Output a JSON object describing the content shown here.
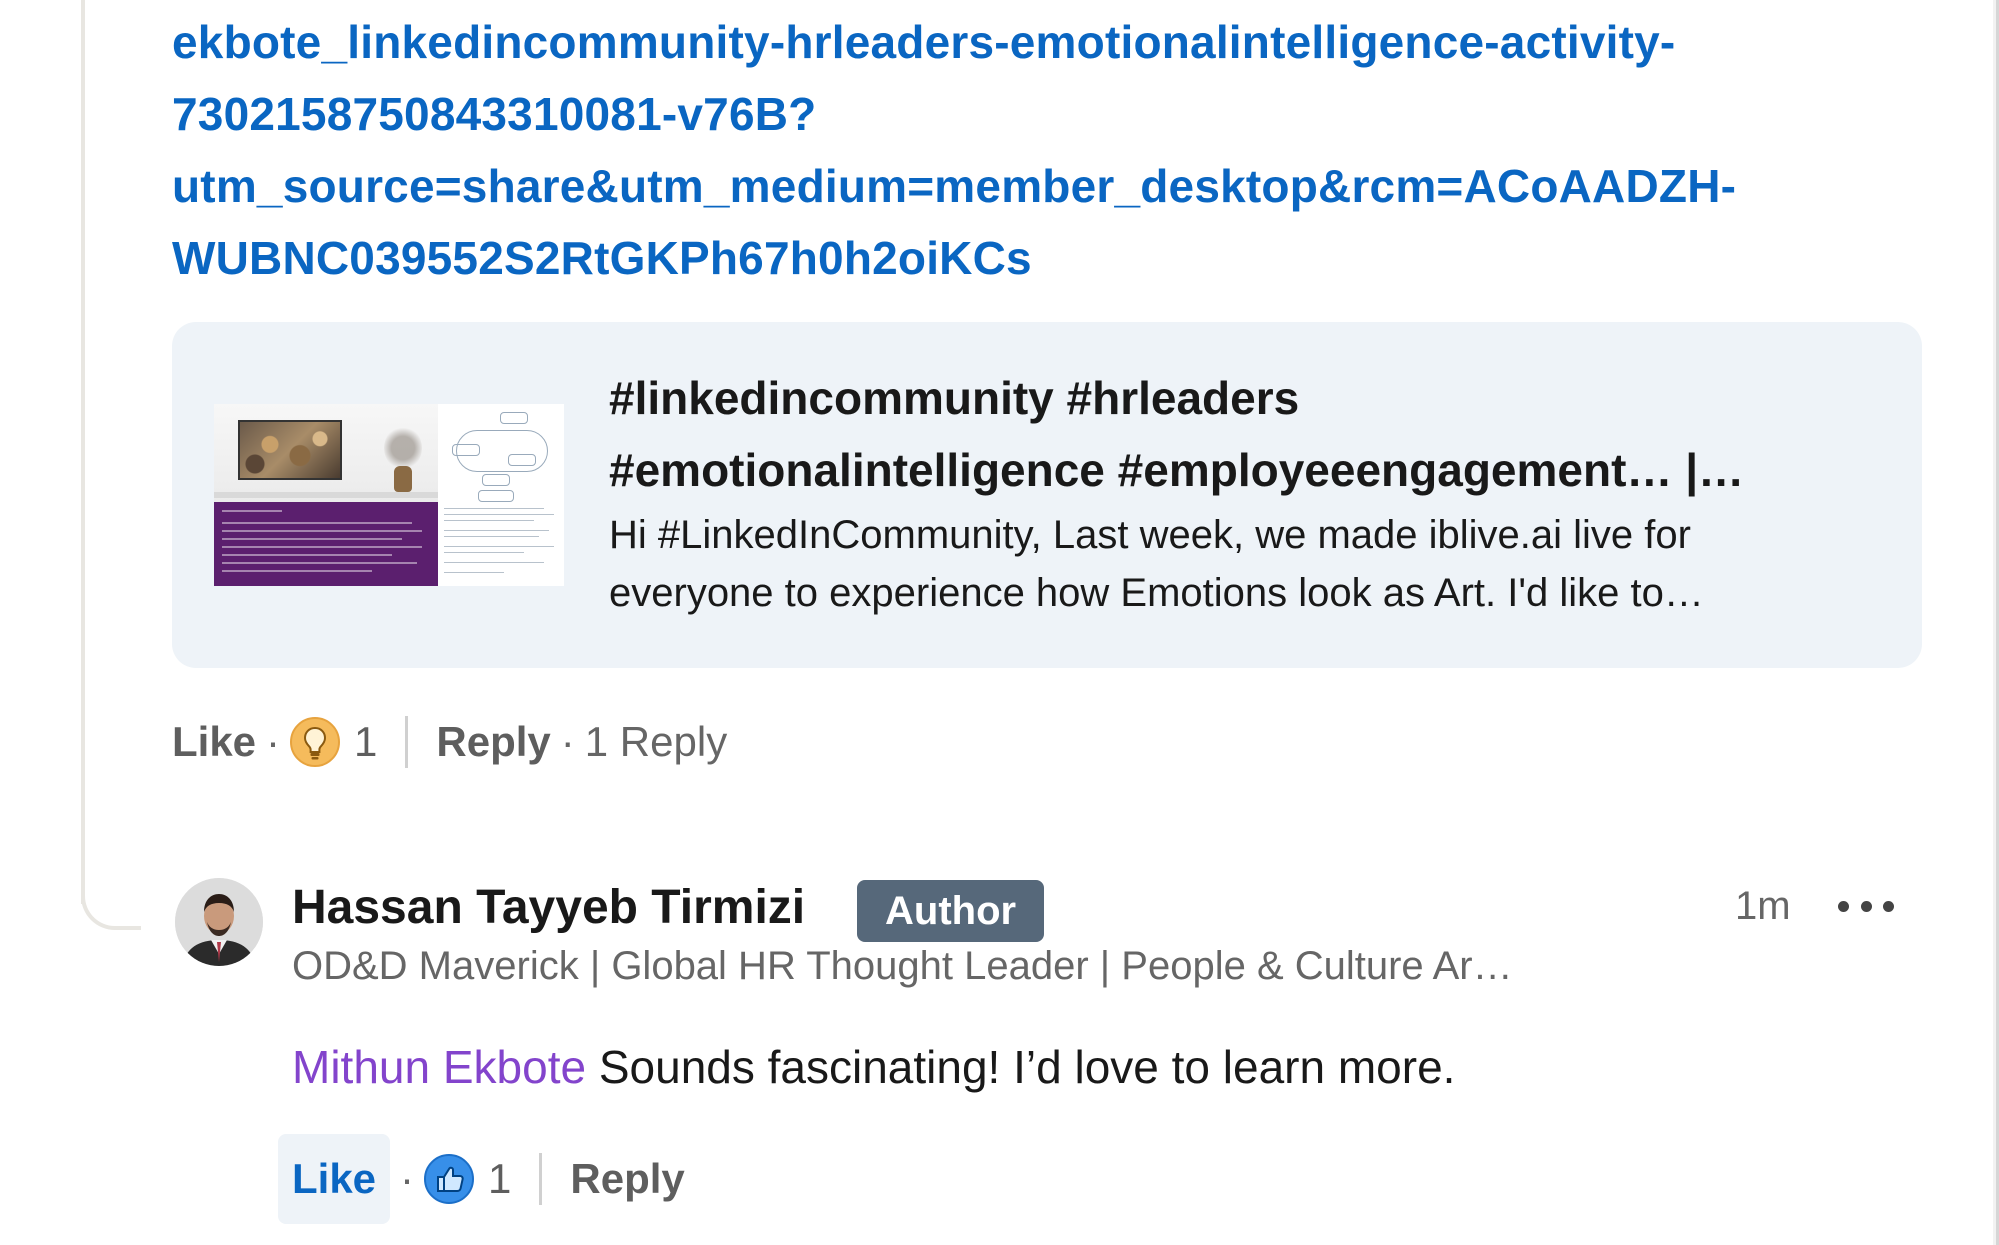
{
  "link": {
    "lines": [
      "ekbote_linkedincommunity-hrleaders-emotionalintelligence-activity-",
      "7302158750843310081-v76B?",
      "utm_source=share&utm_medium=member_desktop&rcm=ACoAADZH-",
      "WUBNC039552S2RtGKPh67h0h2oiKCs"
    ]
  },
  "preview": {
    "title_lines": [
      "#linkedincommunity #hrleaders",
      "#emotionalintelligence #employeeengagement… |…"
    ],
    "desc_lines": [
      "Hi #LinkedInCommunity, Last week, we made iblive.ai live for",
      "everyone to experience how Emotions look as Art. I'd like to…"
    ]
  },
  "parent_actions": {
    "like_label": "Like",
    "reaction_icon": "insightful-bulb-icon",
    "reaction_count": "1",
    "reply_label": "Reply",
    "replies_count_label": "1 Reply"
  },
  "comment": {
    "author": "Hassan Tayyeb Tirmizi",
    "badge": "Author",
    "time": "1m",
    "headline": "OD&D Maverick | Global HR Thought Leader | People & Culture Ar…",
    "mention": "Mithun Ekbote",
    "text": " Sounds fascinating! I’d love to learn more.",
    "actions": {
      "like_label": "Like",
      "reaction_icon": "like-thumb-icon",
      "reaction_count": "1",
      "reply_label": "Reply"
    }
  },
  "colors": {
    "link": "#0a66c2",
    "mention": "#8344cc",
    "badge_bg": "#56687a",
    "card_bg": "#eef3f8"
  }
}
